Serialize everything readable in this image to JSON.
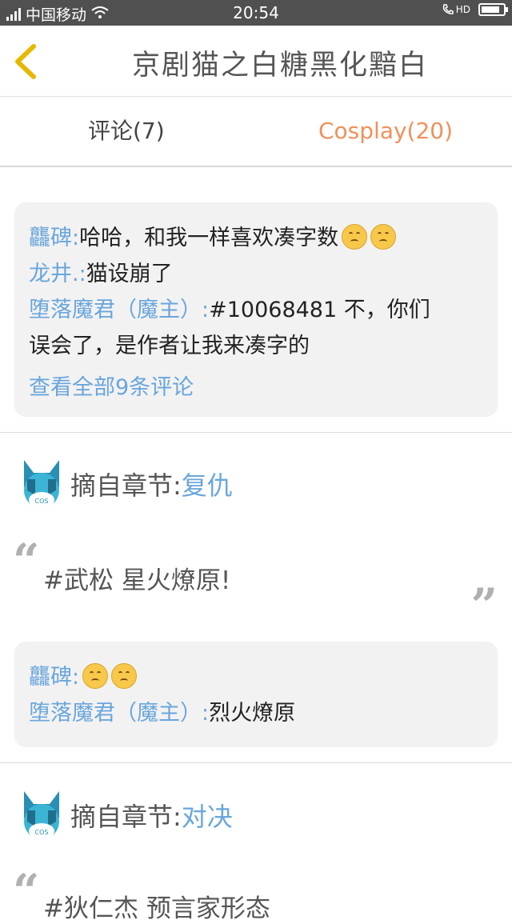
{
  "status_bar": {
    "carrier": "中国移动",
    "time": "20:54",
    "hd": "HD",
    "battery_level": 0.85
  },
  "header": {
    "title": "京剧猫之白糖黑化黯白"
  },
  "tabs": [
    {
      "label": "评论(7)"
    },
    {
      "label": "Cosplay(20)"
    }
  ],
  "comment_box_1": {
    "comments": [
      {
        "user": "龘碑:",
        "text": "哈哈，和我一样喜欢凑字数",
        "emoji_count": 2
      },
      {
        "user": "龙井.:",
        "text": "猫设崩了"
      },
      {
        "user": "堕落魔君（魔主）:",
        "text": "#10068481 不，你们",
        "text2": "误会了，是作者让我来凑字的"
      }
    ],
    "view_all": "查看全部9条评论"
  },
  "post_1": {
    "chapter_label": "摘自章节: ",
    "chapter_name": "复仇",
    "text": "#武松 星火燎原!",
    "avatar_text": "COS"
  },
  "comment_box_2": {
    "comments": [
      {
        "user": "龘碑:",
        "text": "",
        "emoji_count": 2
      },
      {
        "user": "堕落魔君（魔主）:",
        "text": "烈火燎原"
      }
    ]
  },
  "post_2": {
    "chapter_label": "摘自章节: ",
    "chapter_name": "对决",
    "text": "#狄仁杰 预言家形态",
    "avatar_text": "COS"
  },
  "colors": {
    "accent_orange": "#f0905a",
    "link_blue": "#6aa6dc",
    "back_arrow": "#e6b800"
  }
}
